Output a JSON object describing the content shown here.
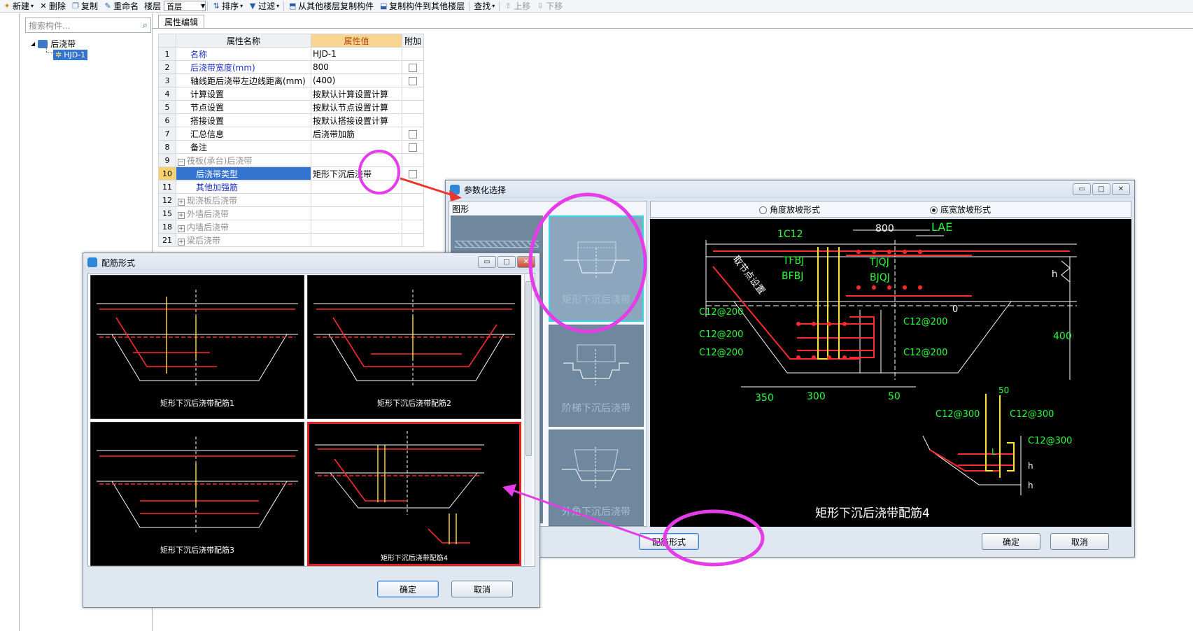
{
  "toolbar": {
    "new": "新建",
    "delete": "删除",
    "copy": "复制",
    "rename": "重命名",
    "floor_label": "楼层",
    "floor_value": "首层",
    "sort": "排序",
    "filter": "过滤",
    "copy_from_floor": "从其他楼层复制构件",
    "copy_to_floor": "复制构件到其他楼层",
    "find": "查找",
    "move_up": "上移",
    "move_down": "下移"
  },
  "search": {
    "placeholder": "搜索构件..."
  },
  "tree": {
    "root": "后浇带",
    "child": "HJD-1"
  },
  "tab_label": "属性编辑",
  "grid": {
    "headers": [
      "属性名称",
      "属性值",
      "附加"
    ],
    "rows": [
      {
        "num": "1",
        "name": "名称",
        "value": "HJD-1"
      },
      {
        "num": "2",
        "name": "后浇带宽度(mm)",
        "value": "800"
      },
      {
        "num": "3",
        "name": "轴线距后浇带左边线距离(mm)",
        "value": "(400)"
      },
      {
        "num": "4",
        "name": "计算设置",
        "value": "按默认计算设置计算"
      },
      {
        "num": "5",
        "name": "节点设置",
        "value": "按默认节点设置计算"
      },
      {
        "num": "6",
        "name": "搭接设置",
        "value": "按默认搭接设置计算"
      },
      {
        "num": "7",
        "name": "汇总信息",
        "value": "后浇带加筋"
      },
      {
        "num": "8",
        "name": "备注",
        "value": ""
      },
      {
        "num": "9",
        "name": "筏板(承台)后浇带",
        "value": ""
      },
      {
        "num": "10",
        "name": "后浇带类型",
        "value": "矩形下沉后浇带"
      },
      {
        "num": "11",
        "name": "其他加强筋",
        "value": ""
      },
      {
        "num": "12",
        "name": "现浇板后浇带",
        "value": ""
      },
      {
        "num": "15",
        "name": "外墙后浇带",
        "value": ""
      },
      {
        "num": "18",
        "name": "内墙后浇带",
        "value": ""
      },
      {
        "num": "21",
        "name": "梁后浇带",
        "value": ""
      }
    ]
  },
  "param_window": {
    "title": "参数化选择",
    "shape_label": "图形",
    "radio_angle": "角度放坡形式",
    "radio_width": "底宽放坡形式",
    "tiles": [
      "矩形下沉后浇带",
      "阶梯下沉后浇带",
      "外角下沉后浇带"
    ],
    "btn_rebar": "配筋形式",
    "btn_ok": "确定",
    "btn_cancel": "取消",
    "preview": {
      "caption": "矩形下沉后浇带配筋4",
      "labels": {
        "dim800": "800",
        "lae": "LAE",
        "c12": "1C12",
        "tfbj": "TFBJ",
        "bfbj": "BFBJ",
        "tjqj": "TJQJ",
        "bjqj": "BJQJ",
        "node": "取节点设置",
        "h": "h",
        "zero": "0",
        "d400": "400",
        "c12_200": "C12@200",
        "d350": "350",
        "d300": "300",
        "d50": "50",
        "c12_300": "C12@300",
        "l": "L"
      }
    }
  },
  "rebar_window": {
    "title": "配筋形式",
    "thumbs": [
      "矩形下沉后浇带配筋1",
      "矩形下沉后浇带配筋2",
      "矩形下沉后浇带配筋3",
      "矩形下沉后浇带配筋4"
    ],
    "btn_ok": "确定",
    "btn_cancel": "取消"
  }
}
